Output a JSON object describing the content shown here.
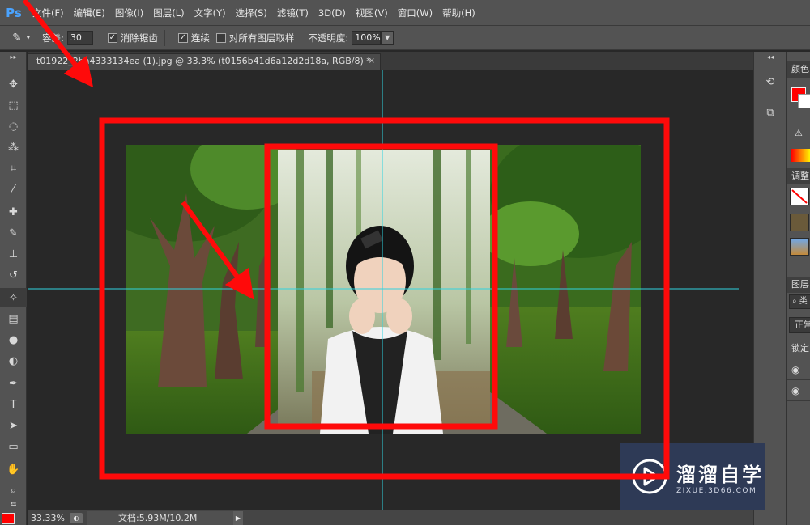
{
  "menubar": {
    "logo": "Ps",
    "items": [
      "文件(F)",
      "编辑(E)",
      "图像(I)",
      "图层(L)",
      "文字(Y)",
      "选择(S)",
      "滤镜(T)",
      "3D(D)",
      "视图(V)",
      "窗口(W)",
      "帮助(H)"
    ]
  },
  "options": {
    "tolerance_label": "容差:",
    "tolerance_value": "30",
    "antialias_label": "消除锯齿",
    "antialias_checked": true,
    "contiguous_label": "连续",
    "contiguous_checked": true,
    "sample_all_label": "对所有图层取样",
    "sample_all_checked": false,
    "opacity_label": "不透明度:",
    "opacity_value": "100%"
  },
  "document": {
    "tab_title": "t01922_2ba4333134ea (1).jpg @ 33.3% (t0156b41d6a12d2d18a, RGB/8) *",
    "tab_close": "×"
  },
  "statusbar": {
    "zoom": "33.33%",
    "doc_info": "文档:5.93M/10.2M"
  },
  "panels": {
    "color_title": "颜色",
    "adjust_title": "调整",
    "layers_title": "图层",
    "blend_mode": "正常",
    "lock_label": "锁定",
    "search_text": "类"
  },
  "watermark": {
    "title": "溜溜自学",
    "subtitle": "ZIXUE.3D66.COM"
  },
  "colors": {
    "foreground": "#ff0000",
    "background": "#ffffff",
    "annotation": "#ff0a0a",
    "guide": "#2fd3e0"
  },
  "icons": {
    "tools": [
      "move-icon",
      "marquee-icon",
      "lasso-icon",
      "quick-select-icon",
      "crop-icon",
      "eyedropper-icon",
      "healing-icon",
      "brush-icon",
      "stamp-icon",
      "history-brush-icon",
      "magic-eraser-icon",
      "gradient-icon",
      "blur-icon",
      "dodge-icon",
      "pen-icon",
      "type-icon",
      "path-select-icon",
      "shape-icon",
      "hand-icon",
      "zoom-icon"
    ]
  }
}
